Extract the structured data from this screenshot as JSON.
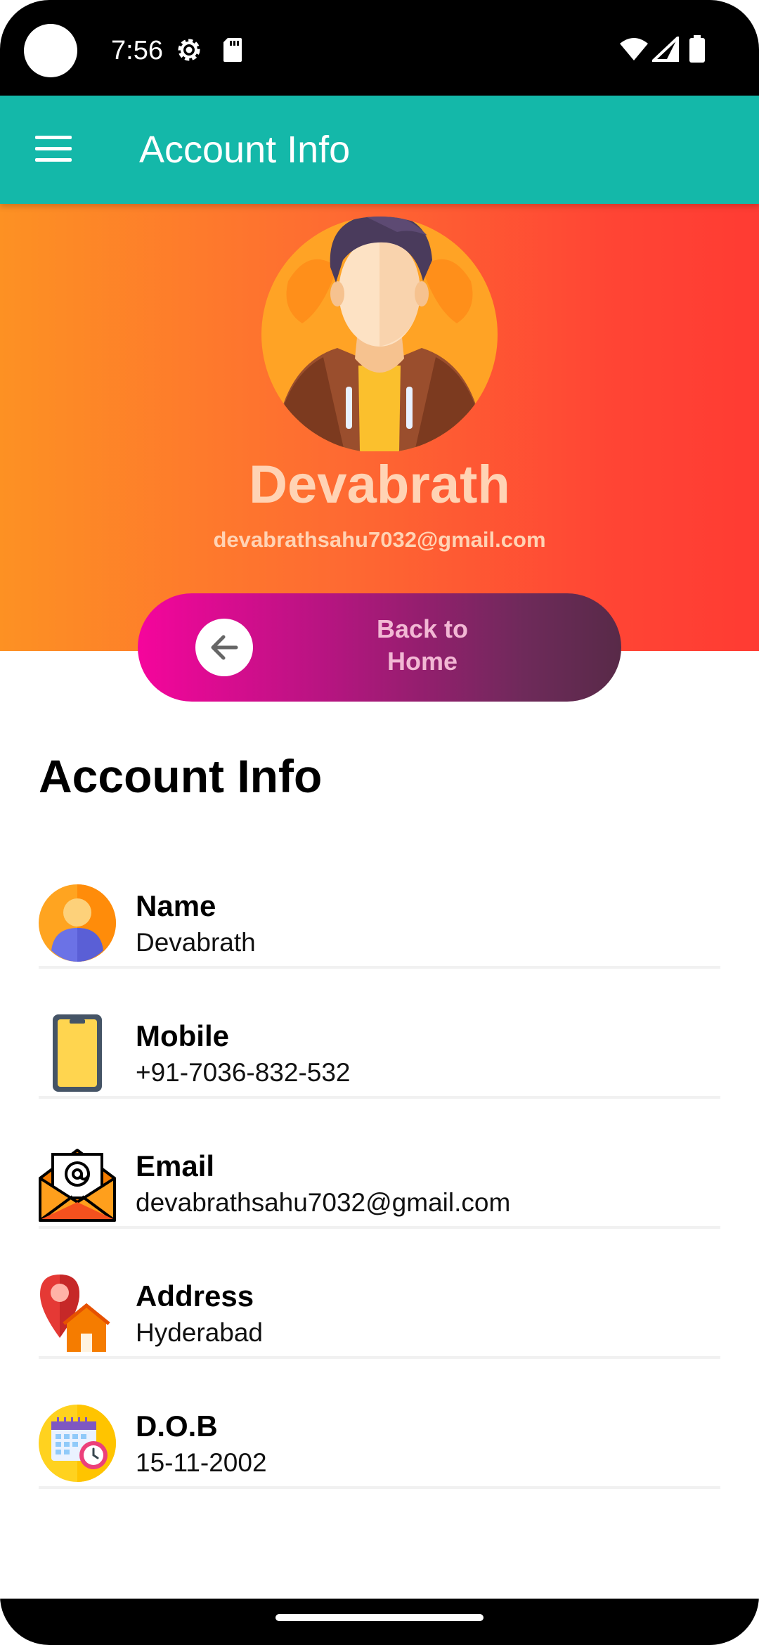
{
  "status_bar": {
    "time": "7:56",
    "icons": [
      "settings-icon",
      "sd-card-icon",
      "wifi-icon",
      "signal-icon",
      "battery-icon"
    ]
  },
  "app_bar": {
    "title": "Account Info",
    "menu_icon": "hamburger-menu-icon",
    "color": "#14b8a9"
  },
  "profile": {
    "name": "Devabrath",
    "email": "devabrathsahu7032@gmail.com",
    "avatar": "male-avatar-icon"
  },
  "back_button": {
    "line1": "Back to",
    "line2": "Home",
    "icon": "arrow-left-icon"
  },
  "section": {
    "title": "Account Info"
  },
  "info": [
    {
      "label": "Name",
      "value": "Devabrath",
      "icon": "user-icon"
    },
    {
      "label": "Mobile",
      "value": "+91-7036-832-532",
      "icon": "mobile-phone-icon"
    },
    {
      "label": "Email",
      "value": "devabrathsahu7032@gmail.com",
      "icon": "envelope-icon"
    },
    {
      "label": "Address",
      "value": "Hyderabad",
      "icon": "location-home-icon"
    },
    {
      "label": "D.O.B",
      "value": "15-11-2002",
      "icon": "calendar-icon"
    }
  ],
  "colors": {
    "hero_gradient": [
      "#fd9123",
      "#ff3b33"
    ],
    "button_gradient": [
      "#f5059c",
      "#582a48"
    ],
    "hero_text": "#ffd3b4"
  }
}
